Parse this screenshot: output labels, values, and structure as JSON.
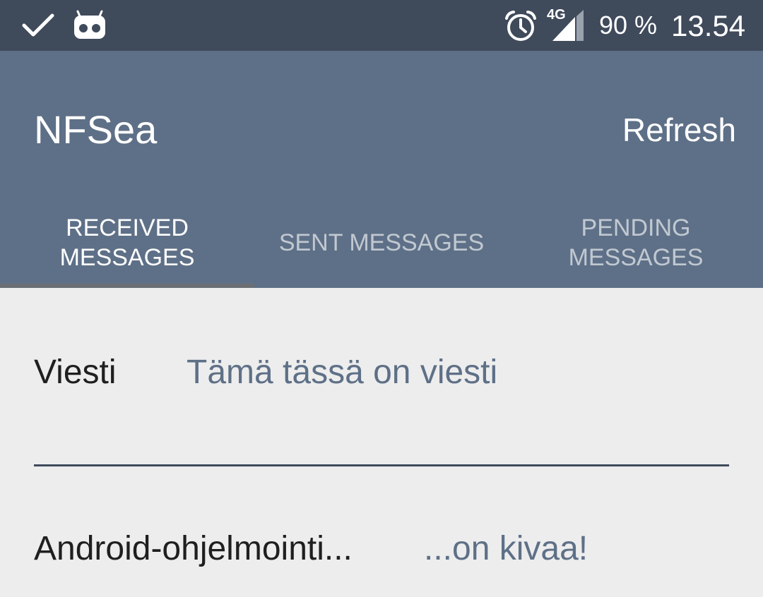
{
  "status_bar": {
    "icons": [
      "check-icon",
      "cyanogen-bot-icon",
      "alarm-clock-icon",
      "signal-4g-icon"
    ],
    "network_label": "4G",
    "battery": "90 %",
    "time": "13.54"
  },
  "app_bar": {
    "title": "NFSea",
    "refresh_label": "Refresh",
    "color": "#5e7087"
  },
  "tabs": [
    {
      "label": "RECEIVED MESSAGES",
      "active": true
    },
    {
      "label": "SENT MESSAGES",
      "active": false
    },
    {
      "label": "PENDING MESSAGES",
      "active": false
    }
  ],
  "messages": [
    {
      "title": "Viesti",
      "text": "Tämä tässä on viesti"
    },
    {
      "title": "Android-ohjelmointi...",
      "text": "...on kivaa!"
    }
  ]
}
